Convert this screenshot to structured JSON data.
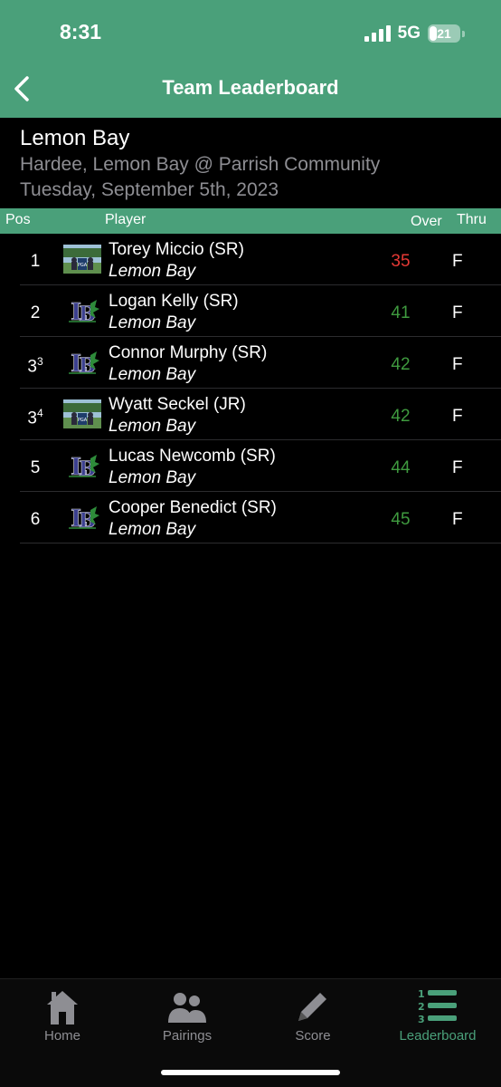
{
  "status_bar": {
    "time": "8:31",
    "network": "5G",
    "battery": "21"
  },
  "nav": {
    "title": "Team Leaderboard"
  },
  "event": {
    "team": "Lemon Bay",
    "match": "Hardee, Lemon Bay @ Parrish Community",
    "date": "Tuesday, September 5th, 2023"
  },
  "columns": {
    "pos": "Pos",
    "player": "Player",
    "over": "Over",
    "thru": "Thru"
  },
  "rows": [
    {
      "pos": "1",
      "pos_sup": "",
      "name": "Torey Miccio (SR)",
      "team": "Lemon Bay",
      "over": "35",
      "thru": "F",
      "avatar": "photo"
    },
    {
      "pos": "2",
      "pos_sup": "",
      "name": "Logan Kelly (SR)",
      "team": "Lemon Bay",
      "over": "41",
      "thru": "F",
      "avatar": "logo"
    },
    {
      "pos": "3",
      "pos_sup": "3",
      "name": "Connor Murphy (SR)",
      "team": "Lemon Bay",
      "over": "42",
      "thru": "F",
      "avatar": "logo"
    },
    {
      "pos": "3",
      "pos_sup": "4",
      "name": "Wyatt Seckel (JR)",
      "team": "Lemon Bay",
      "over": "42",
      "thru": "F",
      "avatar": "photo"
    },
    {
      "pos": "5",
      "pos_sup": "",
      "name": "Lucas Newcomb (SR)",
      "team": "Lemon Bay",
      "over": "44",
      "thru": "F",
      "avatar": "logo"
    },
    {
      "pos": "6",
      "pos_sup": "",
      "name": "Cooper Benedict (SR)",
      "team": "Lemon Bay",
      "over": "45",
      "thru": "F",
      "avatar": "logo"
    }
  ],
  "tabs": [
    {
      "label": "Home",
      "icon": "home-icon",
      "active": false
    },
    {
      "label": "Pairings",
      "icon": "people-icon",
      "active": false
    },
    {
      "label": "Score",
      "icon": "pencil-icon",
      "active": false
    },
    {
      "label": "Leaderboard",
      "icon": "leaderboard-icon",
      "active": true
    }
  ],
  "colors": {
    "accent": "#4aa07a",
    "tab_active": "#4aa07a",
    "tab_inactive": "#8e8e93",
    "score_low": "#e53935",
    "score_normal": "#3f9a3f",
    "secondary_text": "#8e8e93"
  }
}
